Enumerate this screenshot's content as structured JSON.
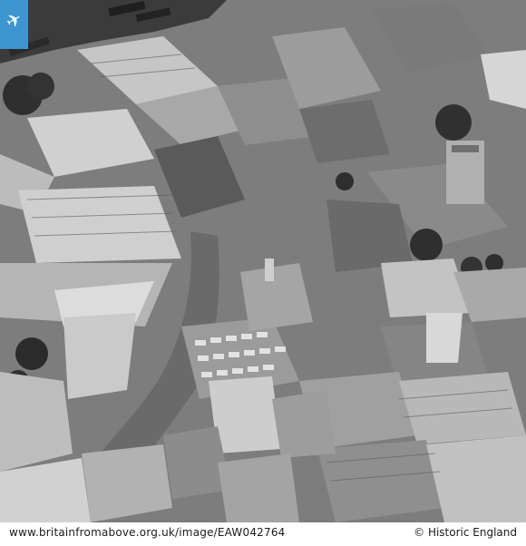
{
  "photo": {
    "caption_url": "www.britainfromabove.org.uk/image/EAW042764",
    "credit": "© Historic England",
    "badge_icon": "airplane-icon",
    "palette": {
      "badge": "#3d95cf",
      "river": "#3b3b3b",
      "roof_light": "#c8c8c8",
      "roof_mid": "#9a9a9a",
      "roof_dark": "#4a4a4a",
      "street": "#6e6e6e",
      "trees": "#2f2f2f"
    }
  }
}
